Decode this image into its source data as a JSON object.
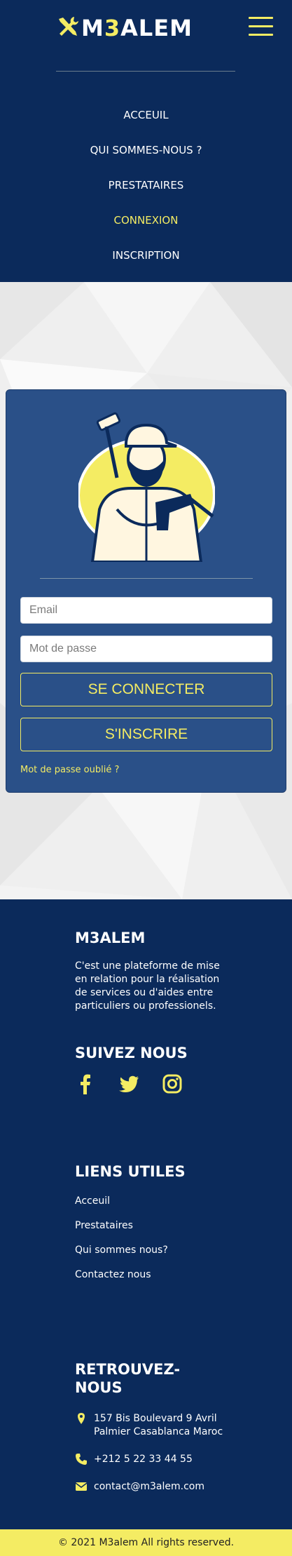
{
  "colors": {
    "navy": "#0b2a5b",
    "card": "#2a5088",
    "accent": "#f4ec63",
    "white": "#ffffff"
  },
  "brand": {
    "name_prefix": "M",
    "name_digit": "3",
    "name_suffix": "ALEM",
    "icon": "tools-icon"
  },
  "header": {
    "menu_icon": "hamburger-menu-icon"
  },
  "nav": {
    "items": [
      {
        "label": "ACCEUIL"
      },
      {
        "label": "QUI SOMMES-NOUS ?"
      },
      {
        "label": "PRESTATAIRES"
      },
      {
        "label": "CONNEXION",
        "active": true
      },
      {
        "label": "INSCRIPTION"
      }
    ]
  },
  "login": {
    "illustration": "handyman-with-drill-illustration",
    "email_placeholder": "Email",
    "password_placeholder": "Mot de passe",
    "login_button": "SE CONNECTER",
    "signup_button": "S'INSCRIRE",
    "forgot_link": "Mot de passe oublié ?"
  },
  "footer": {
    "about_title": "M3ALEM",
    "about_text": "C'est une plateforme de mise en relation pour la réalisation de services ou d'aides entre particuliers ou professionels.",
    "follow_title": "SUIVEZ NOUS",
    "social": [
      "facebook-icon",
      "twitter-icon",
      "instagram-icon"
    ],
    "links_title": "LIENS UTILES",
    "links": [
      "Acceuil",
      "Prestataires",
      "Qui sommes nous?",
      "Contactez nous"
    ],
    "contact_title_line1": "RETROUVEZ-",
    "contact_title_line2": "NOUS",
    "address_line1": "157 Bis Boulevard 9 Avril",
    "address_line2": "Palmier Casablanca Maroc",
    "phone": "+212 5 22 33 44 55",
    "email": "contact@m3alem.com"
  },
  "copyright": "© 2021 M3alem All rights reserved."
}
